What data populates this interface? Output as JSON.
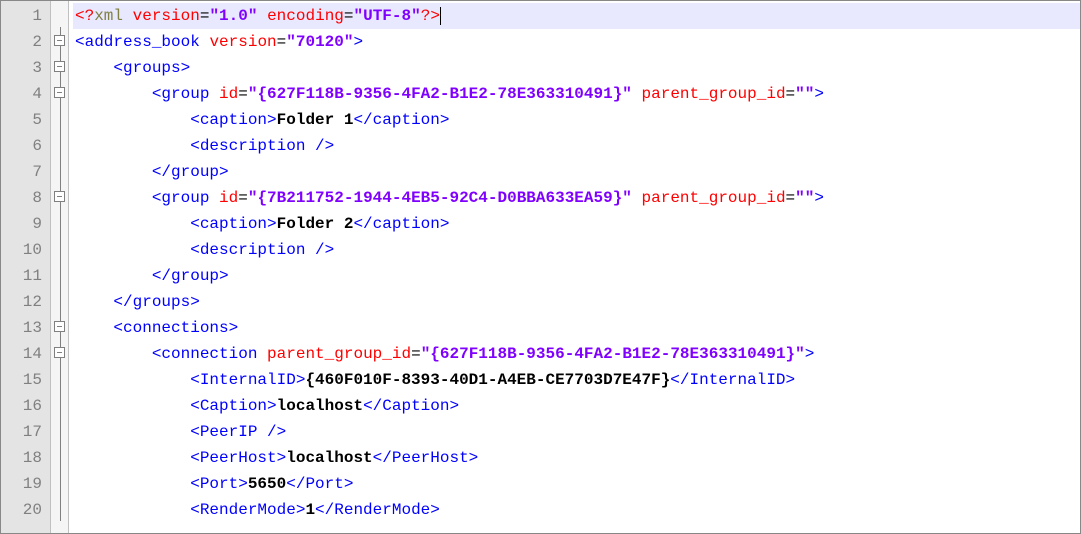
{
  "line_count": 20,
  "current_line": 1,
  "fold": {
    "1": "",
    "2": "box",
    "3": "box",
    "4": "box",
    "5": "line",
    "6": "line",
    "7": "line",
    "8": "box",
    "9": "line",
    "10": "line",
    "11": "line",
    "12": "line",
    "13": "box",
    "14": "box",
    "15": "line",
    "16": "line",
    "17": "line",
    "18": "line",
    "19": "line",
    "20": "line"
  },
  "pi": {
    "target": "xml",
    "attr1": "version",
    "val1": "1.0",
    "attr2": "encoding",
    "val2": "UTF-8"
  },
  "root": {
    "tag": "address_book",
    "attr": "version",
    "val": "70120"
  },
  "groups_tag": "groups",
  "group_tag": "group",
  "id_attr": "id",
  "pg_attr": "parent_group_id",
  "caption_tag": "caption",
  "desc_tag": "description",
  "group1": {
    "id": "{627F118B-9356-4FA2-B1E2-78E363310491}",
    "parent": "",
    "caption": "Folder 1"
  },
  "group2": {
    "id": "{7B211752-1944-4EB5-92C4-D0BBA633EA59}",
    "parent": "",
    "caption": "Folder 2"
  },
  "connections_tag": "connections",
  "connection_tag": "connection",
  "conn": {
    "parent_group_id": "{627F118B-9356-4FA2-B1E2-78E363310491}",
    "InternalID": "{460F010F-8393-40D1-A4EB-CE7703D7E47F}",
    "Caption": "localhost",
    "PeerHost": "localhost",
    "Port": "5650",
    "RenderMode": "1"
  },
  "tags": {
    "InternalID": "InternalID",
    "Caption": "Caption",
    "PeerIP": "PeerIP",
    "PeerHost": "PeerHost",
    "Port": "Port",
    "RenderMode": "RenderMode"
  }
}
